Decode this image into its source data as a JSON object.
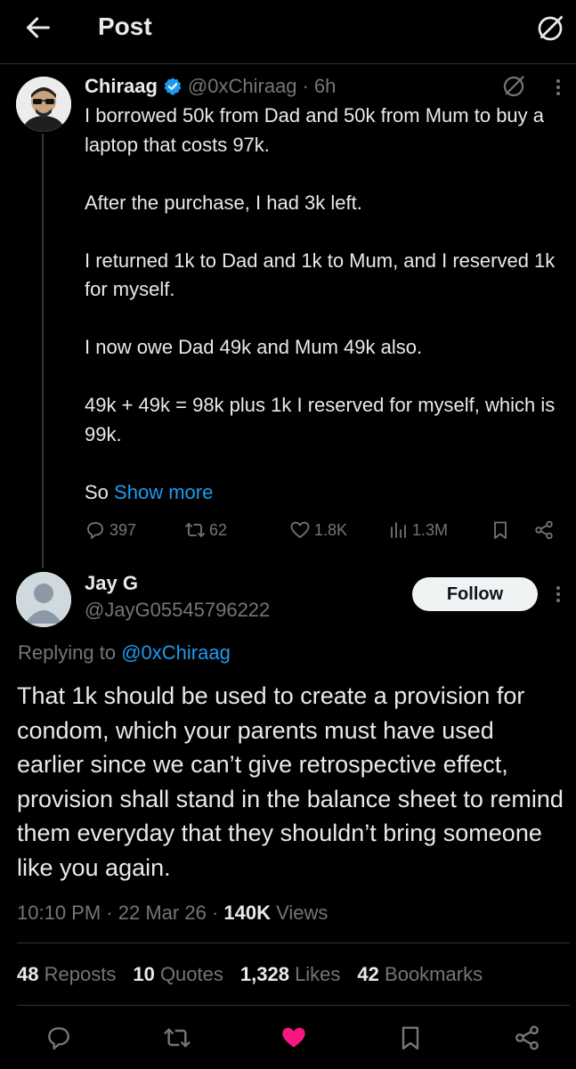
{
  "header": {
    "title": "Post"
  },
  "post": {
    "name": "Chiraag",
    "handle": "@0xChiraag",
    "separator": "·",
    "time": "6h",
    "lines": [
      "I borrowed 50k from Dad and 50k from Mum to buy a laptop that costs 97k.",
      "After the purchase, I had 3k left.",
      "I returned 1k to Dad and 1k to Mum, and I reserved 1k for myself.",
      "I now owe Dad 49k and Mum 49k also.",
      "49k + 49k = 98k plus 1k I reserved for myself, which is 99k."
    ],
    "truncated_text": "So",
    "show_more": "Show more",
    "replies": "397",
    "reposts": "62",
    "likes": "1.8K",
    "views": "1.3M"
  },
  "reply": {
    "name": "Jay G",
    "handle": "@JayG05545796222",
    "follow_label": "Follow",
    "replying_to_label": "Replying to",
    "replying_to_handle": "@0xChiraag",
    "text": "That 1k should be used to create a provision for condom, which your parents must have used earlier since we can’t give retrospective effect, provision shall stand in the balance sheet to remind them everyday that they shouldn’t bring someone like you again.",
    "time": "10:10 PM",
    "date": "22 Mar 26",
    "separator": "·",
    "views_count": "140K",
    "views_label": "Views",
    "stats": {
      "reposts_count": "48",
      "reposts_label": "Reposts",
      "quotes_count": "10",
      "quotes_label": "Quotes",
      "likes_count": "1,328",
      "likes_label": "Likes",
      "bookmarks_count": "42",
      "bookmarks_label": "Bookmarks"
    }
  },
  "icons": {
    "back": "arrow-left-icon",
    "grok": "grok-icon",
    "verified": "verified-badge-icon",
    "more": "more-vertical-icon",
    "reply": "reply-icon",
    "repost": "repost-icon",
    "like": "heart-icon",
    "views": "views-icon",
    "bookmark": "bookmark-icon",
    "share": "share-icon"
  },
  "colors": {
    "background": "#000000",
    "text": "#e7e9ea",
    "muted": "#71767b",
    "accent": "#1d9bf0",
    "like_active": "#f91880",
    "divider": "#2f3336"
  }
}
